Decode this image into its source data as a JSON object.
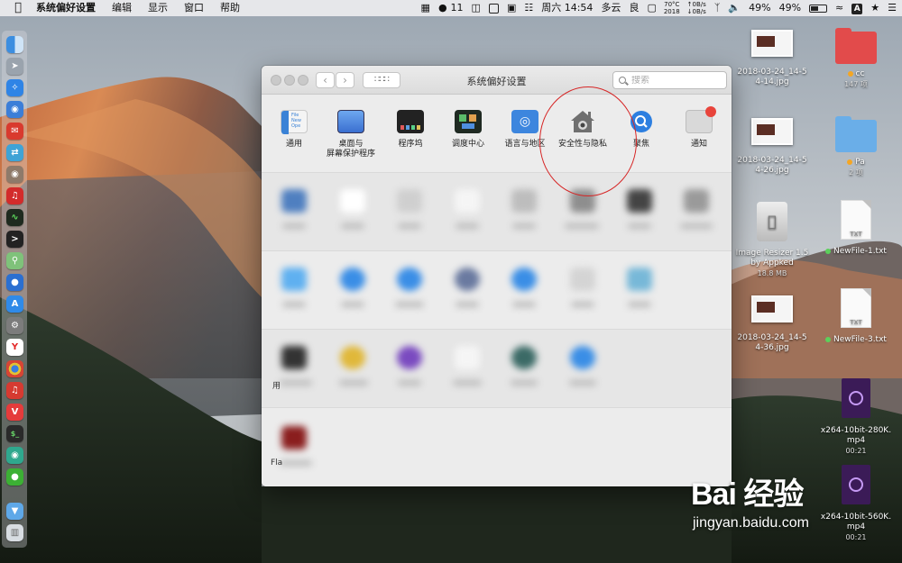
{
  "menubar": {
    "app_name": "系统偏好设置",
    "menus": [
      "编辑",
      "显示",
      "窗口",
      "帮助"
    ],
    "wechat_count": "11",
    "datetime": "周六 14:54",
    "weather": "多云",
    "air_quality": "良",
    "temp_top": "70°C",
    "temp_bottom": "2018",
    "net_up": "0B/s",
    "net_down": "0B/s",
    "battery_1": "49%",
    "battery_2": "49%",
    "input_source": "A"
  },
  "window": {
    "title": "系统偏好设置",
    "search_placeholder": "搜索",
    "panes": [
      {
        "label": "通用"
      },
      {
        "label": "桌面与\n屏幕保护程序"
      },
      {
        "label": "程序坞"
      },
      {
        "label": "调度中心"
      },
      {
        "label": "语言与地区"
      },
      {
        "label": "安全性与隐私"
      },
      {
        "label": "聚焦"
      },
      {
        "label": "通知"
      }
    ],
    "general_icon_text": "File\nNew\nOpe",
    "fragment_row4": "用",
    "fragment_row5": "Fla"
  },
  "desktop": {
    "files": [
      {
        "name": "2018-03-24_14-5\n4-14.jpg"
      },
      {
        "name": "cc",
        "sub": "147 项"
      },
      {
        "name": "2018-03-24_14-5\n4-26.jpg"
      },
      {
        "name": "Pa",
        "sub": "2 项"
      },
      {
        "name": "Image Resizer 1.5\nby Appked",
        "sub": "18.8 MB"
      },
      {
        "name": "NewFile-1.txt"
      },
      {
        "name": "2018-03-24_14-5\n4-36.jpg"
      },
      {
        "name": "NewFile-3.txt"
      },
      {
        "name": "x264-10bit-280K.\nmp4",
        "sub": "00:21"
      },
      {
        "name": "x264-10bit-560K.\nmp4",
        "sub": "00:21"
      }
    ],
    "txt_label": "TXT"
  },
  "watermark": {
    "logo": "Bai 经验",
    "url": "jingyan.baidu.com"
  },
  "colors": {
    "annotation": "#d62424",
    "window_bg": "#ececec"
  }
}
